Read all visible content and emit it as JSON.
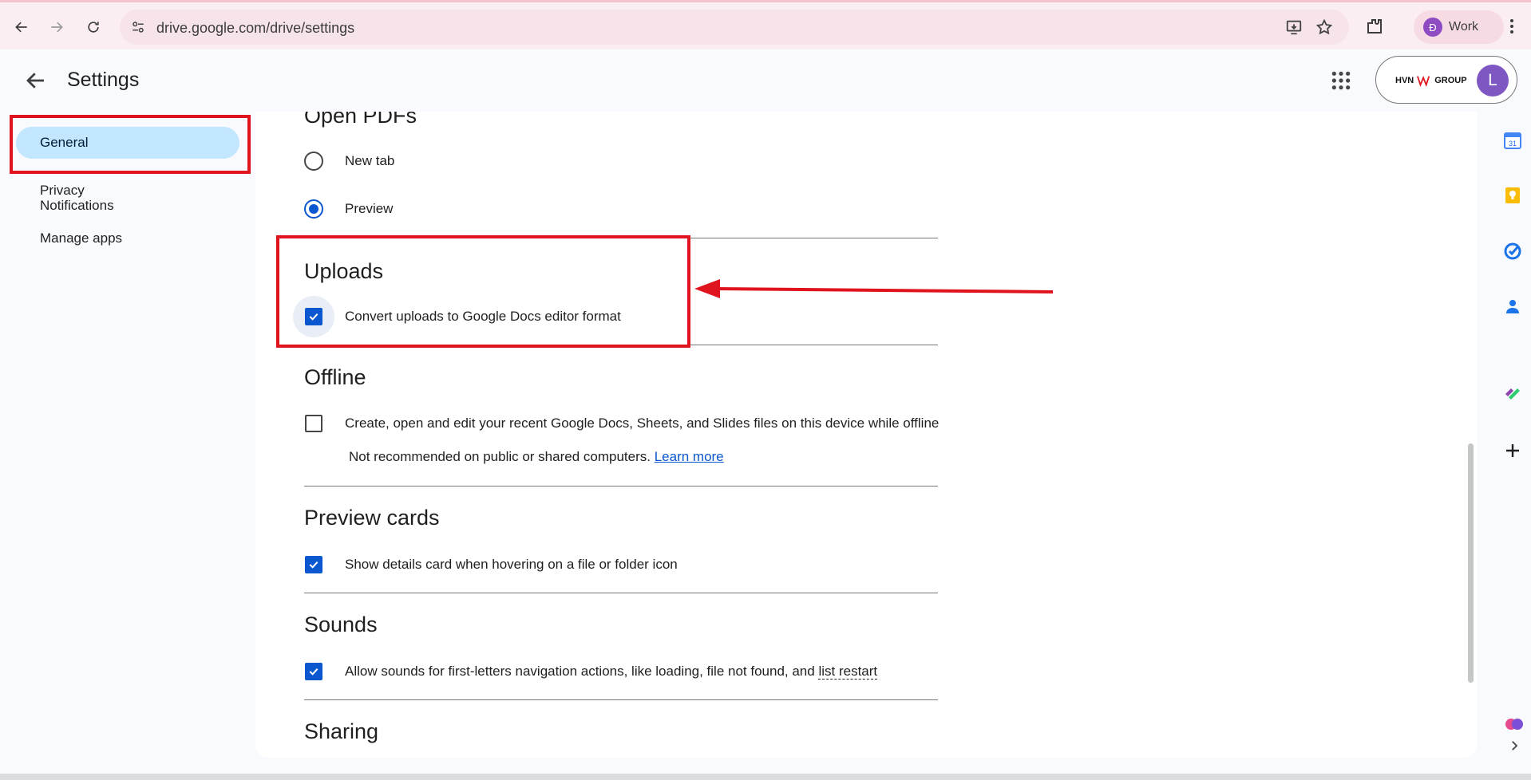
{
  "browser": {
    "url": "drive.google.com/drive/settings",
    "profile_initial": "Đ",
    "profile_label": "Work"
  },
  "header": {
    "title": "Settings",
    "org_logo_text_left": "HVN",
    "org_logo_text_right": "GROUP",
    "user_initial": "L"
  },
  "sidebar": {
    "items": [
      {
        "label": "General",
        "active": true
      },
      {
        "label": "Privacy"
      },
      {
        "label": "Notifications"
      },
      {
        "label": "Manage apps"
      }
    ]
  },
  "sections": {
    "open_pdfs": {
      "title": "Open PDFs",
      "options": [
        {
          "label": "New tab",
          "selected": false
        },
        {
          "label": "Preview",
          "selected": true
        }
      ]
    },
    "uploads": {
      "title": "Uploads",
      "checkbox_label": "Convert uploads to Google Docs editor format",
      "checked": true
    },
    "offline": {
      "title": "Offline",
      "checkbox_label": "Create, open and edit your recent Google Docs, Sheets, and Slides files on this device while offline",
      "checked": false,
      "note": "Not recommended on public or shared computers.",
      "learn_more": "Learn more"
    },
    "preview_cards": {
      "title": "Preview cards",
      "checkbox_label": "Show details card when hovering on a file or folder icon",
      "checked": true
    },
    "sounds": {
      "title": "Sounds",
      "checkbox_label": "Allow sounds for first-letters navigation actions, like loading, file not found, and",
      "checkbox_label_link": "list restart",
      "checked": true
    },
    "sharing": {
      "title": "Sharing"
    }
  },
  "side_panel": {
    "calendar_day": "31"
  },
  "colors": {
    "accent": "#0b57d0",
    "annotation": "#e0141e",
    "active_nav": "#c2e7ff"
  }
}
